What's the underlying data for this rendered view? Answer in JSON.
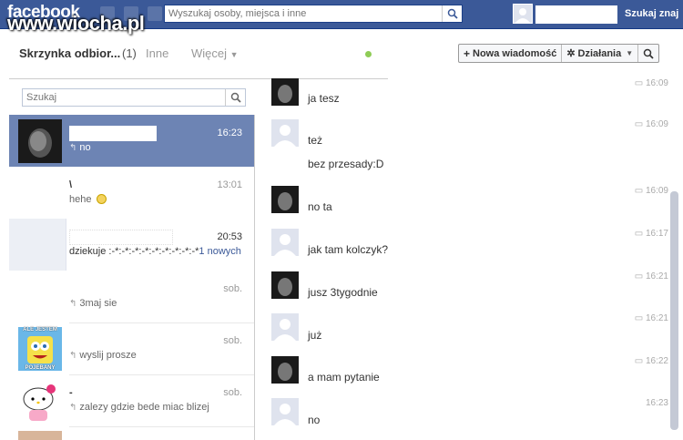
{
  "topbar": {
    "logo": "facebook",
    "search_placeholder": "Wyszukaj osoby, miejsca i inne",
    "find_friends": "Szukaj znaj"
  },
  "watermark": "www.wiocha.pl",
  "inbox": {
    "title": "Skrzynka odbior...",
    "count": "(1)",
    "tab_other": "Inne",
    "tab_more": "Więcej",
    "search_placeholder": "Szukaj"
  },
  "threads": [
    {
      "name": "",
      "time": "16:23",
      "snippet": "no",
      "reply": true,
      "state": "active"
    },
    {
      "name": "\\",
      "time": "13:01",
      "snippet": "hehe",
      "reply": false,
      "state": "read"
    },
    {
      "name": "",
      "time": "20:53",
      "snippet": "dziekuje :-*:-*:-*:-*:-*:-*:-*:-*:-*",
      "new_count": "1 nowych",
      "reply": false,
      "state": "unread"
    },
    {
      "name": "",
      "time": "sob.",
      "snippet": "3maj sie",
      "reply": true,
      "state": "read"
    },
    {
      "name": "",
      "time": "sob.",
      "snippet": "wyslij prosze",
      "reply": true,
      "state": "read",
      "thumb_caption_top": "ALE JESTEM",
      "thumb_caption_bottom": "POJEBANY"
    },
    {
      "name": "-",
      "time": "sob.",
      "snippet": "zalezy gdzie bede miac blizej",
      "reply": true,
      "state": "read"
    }
  ],
  "actions": {
    "new_message": "Nowa wiadomość",
    "actions": "Działania"
  },
  "messages": [
    {
      "text": "ja tesz",
      "time": "16:09",
      "avatar": "dark"
    },
    {
      "text": "też",
      "time": "16:09",
      "avatar": "blank"
    },
    {
      "text": "bez przesady:D",
      "time": "",
      "avatar": "none"
    },
    {
      "text": "no ta",
      "time": "16:09",
      "avatar": "dark"
    },
    {
      "text": "jak tam kolczyk?",
      "time": "16:17",
      "avatar": "blank"
    },
    {
      "text": "jusz 3tygodnie",
      "time": "16:21",
      "avatar": "dark"
    },
    {
      "text": "już",
      "time": "16:21",
      "avatar": "blank"
    },
    {
      "text": "a mam pytanie",
      "time": "16:22",
      "avatar": "dark"
    },
    {
      "text": "no",
      "time": "16:23",
      "avatar": "blank"
    }
  ],
  "colors": {
    "brand": "#3b5998",
    "active_row": "#6d84b4",
    "unread_row": "#eceff5"
  }
}
